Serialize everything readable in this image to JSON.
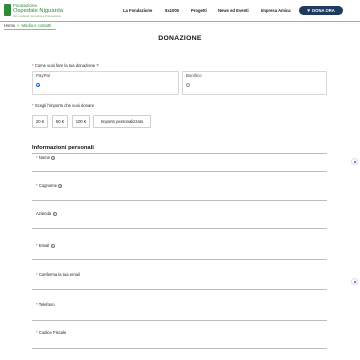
{
  "header": {
    "logo_line1": "Fondazione",
    "logo_line2": "Ospedale Niguarda",
    "logo_line3": "Per i pazienti, la ricerca e l'innovazione",
    "nav": [
      "La Fondazione",
      "5x1000",
      "Progetti",
      "News ed Eventi",
      "Impresa Amica"
    ],
    "donate_label": "DONA ORA",
    "accent": "#2e8b3a",
    "button_color": "#1e3a5f"
  },
  "breadcrumb": {
    "home": "Home",
    "separator": "»",
    "current": "Media e contatti"
  },
  "page": {
    "title": "DONAZIONE"
  },
  "payment": {
    "question_required": "*",
    "question": "Come vuoi fare la tua donazione ?",
    "options": [
      {
        "label": "PayPal",
        "selected": true
      },
      {
        "label": "Bonifico",
        "selected": false
      }
    ]
  },
  "amount": {
    "question_required": "*",
    "question": "Scegli l'importo che vuoi donare",
    "options": [
      "20 €",
      "50 €",
      "100 €",
      "Importo personalizzato"
    ]
  },
  "personal": {
    "section_title": "Informazioni personali",
    "fields": [
      {
        "required": "*",
        "label": "Nome",
        "info": true
      },
      {
        "required": "*",
        "label": "Cognome",
        "info": true
      },
      {
        "required": "",
        "label": "Azienda",
        "info": true
      },
      {
        "required": "*",
        "label": "Email",
        "info": true
      },
      {
        "required": "*",
        "label": "Conferma la tua email",
        "info": false
      },
      {
        "required": "*",
        "label": "Telefono",
        "info": false
      },
      {
        "required": "*",
        "label": "Codice Fiscale",
        "info": false
      }
    ]
  },
  "icons": {
    "logo": "niguarda-logo",
    "donate": "heart-icon",
    "field_info": "info-icon",
    "side_widget": "chat-widget-icon"
  }
}
